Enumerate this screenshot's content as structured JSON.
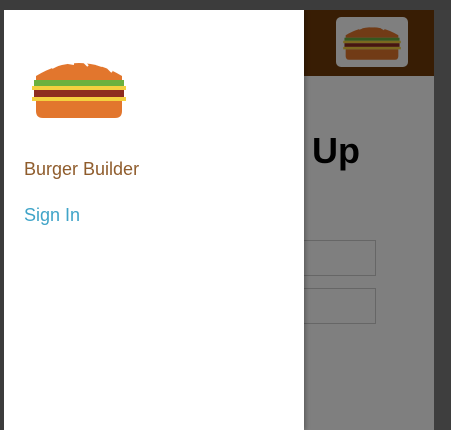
{
  "page": {
    "title": "Sign Up"
  },
  "drawer": {
    "logo_icon": "burger-logo-icon",
    "nav_items": [
      {
        "label": "Burger Builder",
        "active": true
      },
      {
        "label": "Sign In",
        "active": false
      }
    ]
  },
  "toolbar": {
    "logo_icon": "burger-logo-icon"
  },
  "form": {
    "fields": [
      {
        "value": "",
        "placeholder": ""
      },
      {
        "value": "",
        "placeholder": ""
      }
    ]
  },
  "colors": {
    "toolbar": "#703b09",
    "nav_active": "#8f5c2c",
    "nav_link": "#40a4c8"
  }
}
